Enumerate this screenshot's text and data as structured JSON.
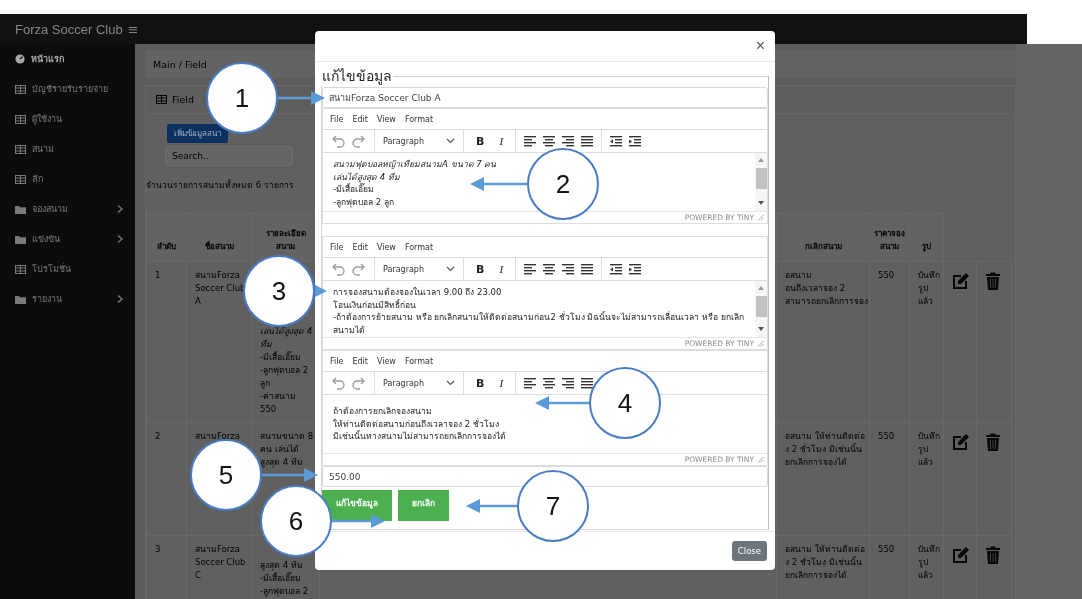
{
  "topbar": {
    "brand": "Forza Soccer Club",
    "menu_glyph": "≡"
  },
  "sidebar": {
    "items": [
      {
        "label": "หน้าแรก",
        "kind": "gauge",
        "selected": true,
        "has_submenu": false
      },
      {
        "label": "บัญชีรายรับรายจ่าย",
        "kind": "table",
        "selected": false,
        "has_submenu": false
      },
      {
        "label": "ผู้ใช้งาน",
        "kind": "table",
        "selected": false,
        "has_submenu": false
      },
      {
        "label": "สนาม",
        "kind": "table",
        "selected": false,
        "has_submenu": false
      },
      {
        "label": "ลีก",
        "kind": "table",
        "selected": false,
        "has_submenu": false
      },
      {
        "label": "จองสนาม",
        "kind": "folder",
        "selected": false,
        "has_submenu": true
      },
      {
        "label": "แข่งขัน",
        "kind": "folder",
        "selected": false,
        "has_submenu": true
      },
      {
        "label": "โปรโมชั่น",
        "kind": "table",
        "selected": false,
        "has_submenu": false
      },
      {
        "label": "รายงาน",
        "kind": "folder",
        "selected": false,
        "has_submenu": true
      }
    ]
  },
  "breadcrumb": "Main / Field",
  "card": {
    "title": "Field",
    "add_button": "เพิ่มข้อมูลสนา",
    "search": {
      "placeholder": "Search.."
    },
    "summary": "จำนวนรายการสนามทั้งหมด 6 รายการ"
  },
  "table": {
    "columns": [
      "ลำดับ",
      "ชื่อสนาม",
      "รายละเอียด สนาม",
      "กเลิกสนาม",
      "ราคาจองสนาม",
      "รูป"
    ],
    "rows": [
      {
        "no": "1",
        "name": "สนามForza Soccer Club A",
        "details": [
          {
            "text": "เล่นได้สูงสุด 4 ทีม",
            "italic": true
          },
          {
            "text": "-มีเสื้อเอี๊ยม",
            "italic": false
          },
          {
            "text": "-ลูกฟุตบอล 2 ลูก",
            "italic": false
          },
          {
            "text": "-ค่าสนาม 550",
            "italic": false
          }
        ],
        "cancellation": [
          "อสนาม",
          "อนถึงเวลาจอง 2",
          "สามารถยกเลิกการจอง"
        ],
        "price": "550",
        "photo": "บันทึกรูปแล้ว"
      },
      {
        "no": "2",
        "name": "สนามForza",
        "details": [
          {
            "text": "สนามขนาด 8 คน เล่นได้ สูงสุด 4 ทีม",
            "italic": false
          }
        ],
        "cancellation": [
          "อสนาม ให้ท่านติดต่อ",
          "ง 2 ชั่วโมง มิเช่นนั้น",
          "ยกเลิกการจองได้"
        ],
        "price": "550",
        "photo": "บันทึกรูปแล้ว"
      },
      {
        "no": "3",
        "name": "สนามForza Soccer Club C",
        "details": [
          {
            "text": "สูงสุด 4 ทีม",
            "italic": false
          },
          {
            "text": "-มีเสื้อเอี๊ยม",
            "italic": false
          },
          {
            "text": "-ลูกฟุตบอล 2",
            "italic": false
          }
        ],
        "cancellation": [
          "อสนาม ให้ท่านติดต่อ",
          "ง 2 ชั่วโมง มิเช่นนั้น",
          "ยกเลิกการจองได้"
        ],
        "price": "550",
        "photo": "บันทึกรูปแล้ว"
      }
    ]
  },
  "modal": {
    "close_glyph": "×",
    "legend": "แก้ไขข้อมูล",
    "name_value": "สนามForza Soccer Club A",
    "editors": [
      {
        "menu": [
          "File",
          "Edit",
          "View",
          "Format"
        ],
        "format": "Paragraph",
        "bold": "B",
        "italic": "I",
        "scrollable": true,
        "branding": "POWERED BY TINY",
        "lines": [
          {
            "text": "สนามฟุตบอลหญ้าเทียมสนามA ขนาด 7 คน",
            "italic": true
          },
          {
            "text": "เล่นได้สูงสุด 4 ทีม",
            "italic": true
          },
          {
            "text": "-มีเสื้อเอี๊ยม",
            "italic": false
          },
          {
            "text": "-ลูกฟุตบอล 2 ลูก",
            "italic": false
          }
        ]
      },
      {
        "menu": [
          "File",
          "Edit",
          "View",
          "Format"
        ],
        "format": "Paragraph",
        "bold": "B",
        "italic": "I",
        "scrollable": true,
        "branding": "POWERED BY TINY",
        "lines": [
          {
            "text": "การจองสนามต้องจองในเวลา 9.00 ถึง 23.00",
            "italic": false
          },
          {
            "text": "โอนเงินก่อนมีสิทธิ์ก่อน",
            "italic": false
          },
          {
            "text": "-ถ้าต้องการย้ายสนาม หรือ ยกเลิกสนามให้ติดต่อสนามก่อน2 ชั่วโมง มิฉนั้นจะไม่สามารถเลื่อนเวลา หรือ ยกเลิก สนามได้",
            "italic": false
          }
        ]
      },
      {
        "menu": [
          "File",
          "Edit",
          "View",
          "Format"
        ],
        "format": "Paragraph",
        "bold": "B",
        "italic": "I",
        "scrollable": false,
        "branding": "POWERED BY TINY",
        "lines": [
          {
            "text": "ถ้าต้องการยกเลิกจองสนาม",
            "italic": false
          },
          {
            "text": "ให้ท่านติดต่อสนามก่อนถึงเวลาจอง 2 ชั่วโมง",
            "italic": false
          },
          {
            "text": "มิเช่นนั้นทางสนามไม่สามารถยกเลิกการจองได้",
            "italic": false
          }
        ]
      }
    ],
    "price_value": "550.00",
    "save_button": "แก้ไขข้อมูล",
    "cancel_button": "ยกเลิก",
    "close_button": "Close"
  },
  "callouts": [
    {
      "label": "1"
    },
    {
      "label": "2"
    },
    {
      "label": "3"
    },
    {
      "label": "4"
    },
    {
      "label": "5"
    },
    {
      "label": "6"
    },
    {
      "label": "7"
    }
  ]
}
